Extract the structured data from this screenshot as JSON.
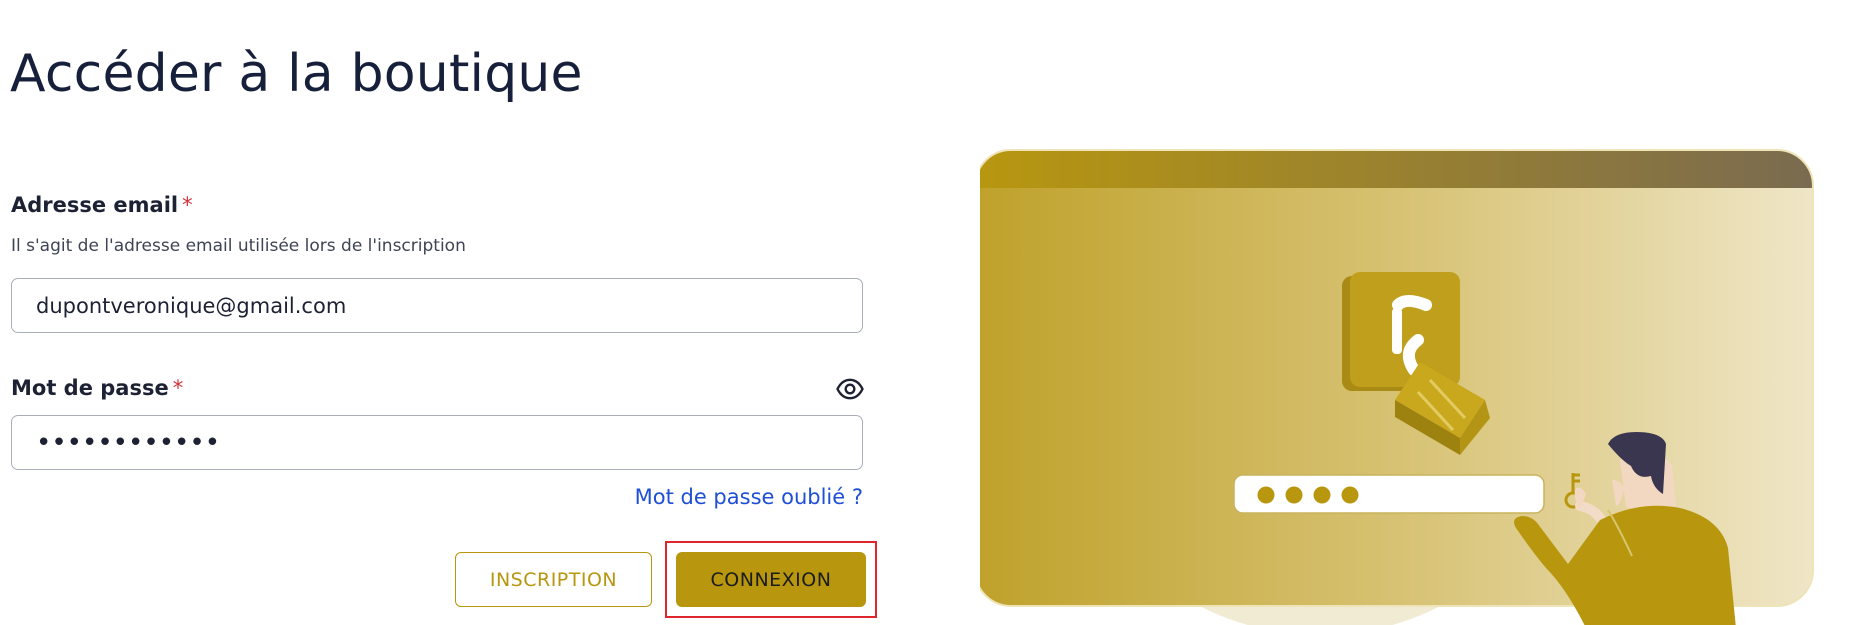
{
  "page": {
    "title": "Accéder à la boutique"
  },
  "form": {
    "email": {
      "label": "Adresse email",
      "required_mark": "*",
      "hint": "Il s'agit de l'adresse email utilisée lors de l'inscription",
      "value": "dupontveronique@gmail.com"
    },
    "password": {
      "label": "Mot de passe",
      "required_mark": "*",
      "masked_value": "••••••••••••"
    },
    "forgot_link": "Mot de passe oublié ?",
    "buttons": {
      "register": "INSCRIPTION",
      "login": "CONNEXION"
    }
  },
  "colors": {
    "brand_gold": "#b8970f",
    "link_blue": "#1e4fd6",
    "required_red": "#d0313a",
    "highlight_red": "#e0262d"
  },
  "icons": {
    "password_toggle": "eye-icon"
  }
}
